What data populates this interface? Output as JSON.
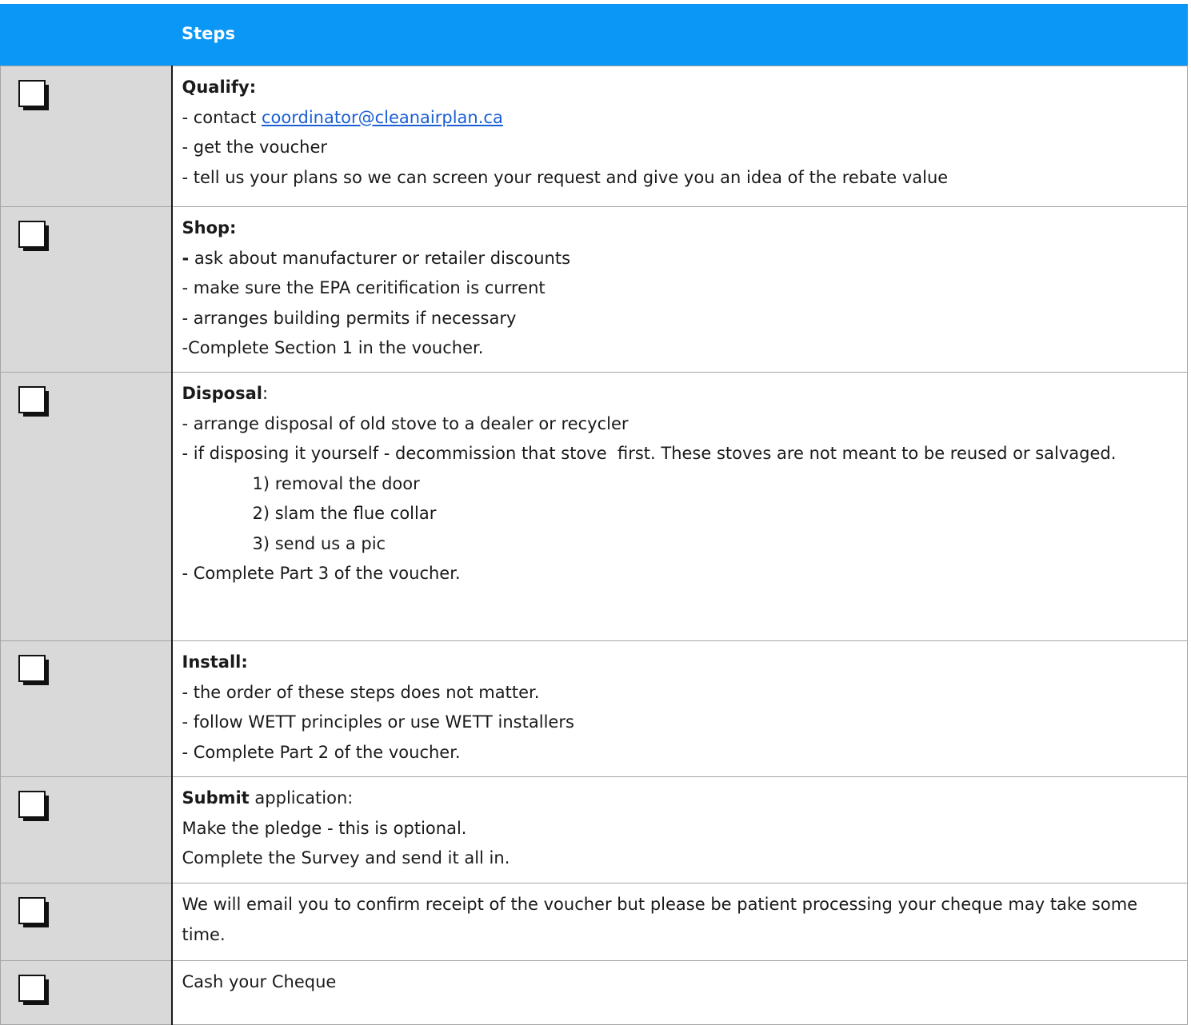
{
  "header": {
    "steps_label": "Steps"
  },
  "rows": [
    {
      "title": "Qualify:",
      "lines": [
        "- contact ",
        "- get the voucher",
        "- tell us your plans so we can screen your request and give you an idea of the rebate value"
      ],
      "email": "coordinator@cleanairplan.ca"
    },
    {
      "title": "Shop:",
      "lines": [
        "-",
        " ask about manufacturer or retailer discounts",
        "- make sure the EPA ceritification is current",
        "- arranges building permits if necessary",
        "-Complete Section 1 in the voucher."
      ]
    },
    {
      "title": "Disposal",
      "title_suffix": ":",
      "lines": [
        "- arrange disposal of old stove to a dealer or recycler",
        "- if disposing it yourself - decommission that stove  first. These stoves are not meant to be reused or salvaged.",
        "1) removal the door",
        "2) slam the flue collar",
        "3) send us a pic",
        "- Complete Part 3 of the voucher."
      ]
    },
    {
      "title": "Install:",
      "lines": [
        "- the order of these steps does not matter.",
        "- follow WETT principles or use WETT installers",
        "- Complete Part 2 of the voucher."
      ]
    },
    {
      "title": "Submit",
      "title_suffix": " application:",
      "lines": [
        "Make the pledge - this is optional.",
        "Complete the Survey and send it all in."
      ]
    },
    {
      "lines": [
        "We will email you to confirm receipt of the voucher but please be patient processing your cheque may take some time."
      ]
    },
    {
      "lines": [
        "Cash your Cheque"
      ]
    }
  ]
}
